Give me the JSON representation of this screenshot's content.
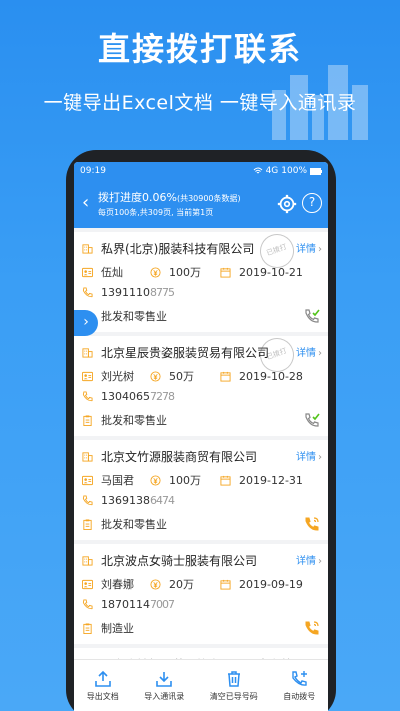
{
  "promo": {
    "headline": "直接拨打联系",
    "subline": "一键导出Excel文档  一键导入通讯录"
  },
  "status": {
    "time": "09:19",
    "network": "4G",
    "battery": "100%"
  },
  "appbar": {
    "title": "拨打进度0.06%",
    "title_sub": "(共30900条数据)",
    "subtitle": "每页100条,共309页, 当前第1页"
  },
  "cards": [
    {
      "company": "私界(北京)服装科技有限公司",
      "detail": "详情",
      "person": "伍灿",
      "capital": "100万",
      "date": "2019-10-21",
      "phone": "1391110",
      "phone_mask": "8775",
      "industry": "批发和零售业",
      "called": true
    },
    {
      "company": "北京星辰贵姿服装贸易有限公司",
      "detail": "详情",
      "person": "刘光树",
      "capital": "50万",
      "date": "2019-10-28",
      "phone": "1304065",
      "phone_mask": "7278",
      "industry": "批发和零售业",
      "called": true
    },
    {
      "company": "北京文竹源服装商贸有限公司",
      "detail": "详情",
      "person": "马国君",
      "capital": "100万",
      "date": "2019-12-31",
      "phone": "1369138",
      "phone_mask": "6474",
      "industry": "批发和零售业",
      "called": false
    },
    {
      "company": "北京波点女骑士服装有限公司",
      "detail": "详情",
      "person": "刘春娜",
      "capital": "20万",
      "date": "2019-09-19",
      "phone": "1870114",
      "phone_mask": "7007",
      "industry": "制造业",
      "called": false
    }
  ],
  "peek_company": "北京含敏娇服装服饰有限公司丰台第",
  "stamp_text": "已拨打",
  "toolbar": {
    "export": "导出文档",
    "import": "导入通讯录",
    "clear": "清空已导号码",
    "autodial": "自动拨号"
  },
  "colors": {
    "primary": "#2d8ff0",
    "accent": "#f5a623",
    "success": "#52c41a"
  }
}
